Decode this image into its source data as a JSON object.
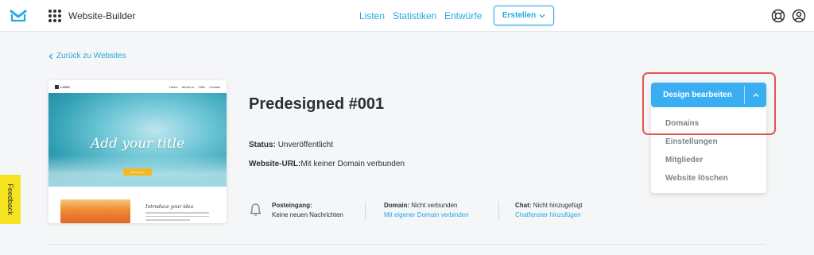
{
  "header": {
    "app_name": "Website-Builder",
    "nav": [
      "Listen",
      "Statistiken",
      "Entwürfe"
    ],
    "create_label": "Erstellen",
    "accent": "#25a8e0"
  },
  "back_label": "Zurück zu Websites",
  "preview": {
    "logo_text": "LOGO",
    "menu": [
      "Home",
      "About us",
      "Offer",
      "Contact"
    ],
    "hero_title": "Add your title",
    "hero_button": "Call to action",
    "intro_title": "Introduce your idea"
  },
  "site": {
    "title": "Predesigned #001",
    "status_label": "Status:",
    "status_value": "Unveröffentlicht",
    "url_label": "Website-URL:",
    "url_value": "Mit keiner Domain verbunden"
  },
  "info": {
    "inbox_label": "Posteingang:",
    "inbox_value": "Keine neuen Nachrichten",
    "domain_label": "Domain:",
    "domain_value": "Nicht verbunden",
    "domain_link": "Mit eigener Domain verbinden",
    "chat_label": "Chat:",
    "chat_value": "Nicht hinzugefügt",
    "chat_link": "Chatfenster hinzufügen"
  },
  "actions": {
    "primary": "Design bearbeiten",
    "menu": [
      "Domains",
      "Einstellungen",
      "Mitglieder",
      "Website löschen"
    ],
    "primary_color": "#3aaef3",
    "highlight_color": "#e2574c"
  },
  "feedback_label": "Feedback"
}
